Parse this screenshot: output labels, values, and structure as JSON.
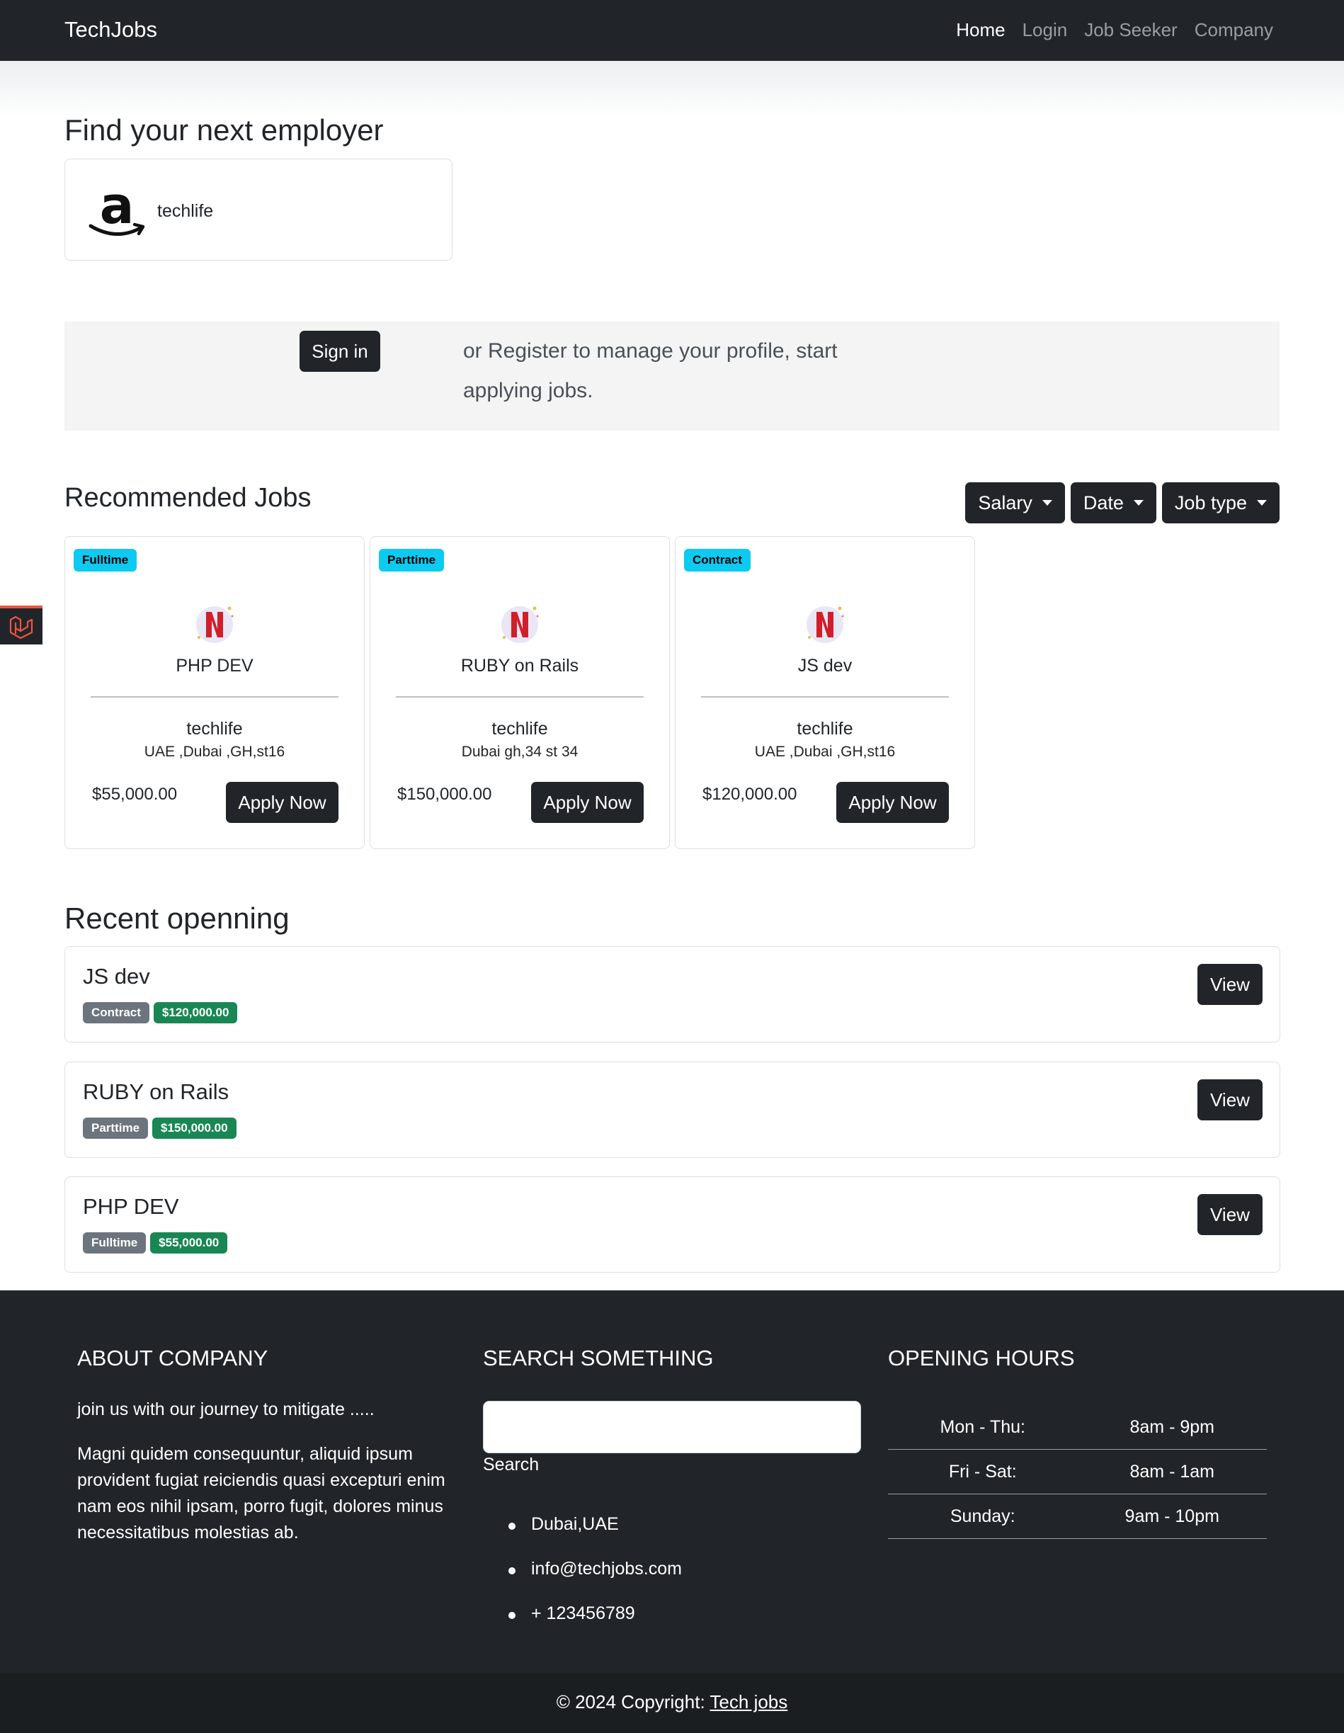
{
  "navbar": {
    "brand": "TechJobs",
    "links": [
      "Home",
      "Login",
      "Job Seeker",
      "Company"
    ],
    "active": "Home"
  },
  "employers": {
    "heading": "Find your next employer",
    "items": [
      {
        "name": "techlife",
        "logo": "amazon-logo"
      }
    ]
  },
  "banner": {
    "signin_label": "Sign in",
    "text": "or Register to manage your profile, start applying jobs."
  },
  "recommended": {
    "heading": "Recommended Jobs",
    "filters": [
      "Salary",
      "Date",
      "Job type"
    ],
    "jobs": [
      {
        "type": "Fulltime",
        "title": "PHP DEV",
        "company": "techlife",
        "location": "UAE ,Dubai ,GH,st16",
        "salary": "$55,000.00",
        "apply_label": "Apply Now",
        "logo": "netflix-logo"
      },
      {
        "type": "Parttime",
        "title": "RUBY on Rails",
        "company": "techlife",
        "location": "Dubai gh,34 st 34",
        "salary": "$150,000.00",
        "apply_label": "Apply Now",
        "logo": "netflix-logo"
      },
      {
        "type": "Contract",
        "title": "JS dev",
        "company": "techlife",
        "location": "UAE ,Dubai ,GH,st16",
        "salary": "$120,000.00",
        "apply_label": "Apply Now",
        "logo": "netflix-logo"
      }
    ]
  },
  "recent": {
    "heading": "Recent openning",
    "items": [
      {
        "title": "JS dev",
        "type": "Contract",
        "salary": "$120,000.00",
        "view_label": "View"
      },
      {
        "title": "RUBY on Rails",
        "type": "Parttime",
        "salary": "$150,000.00",
        "view_label": "View"
      },
      {
        "title": "PHP DEV",
        "type": "Fulltime",
        "salary": "$55,000.00",
        "view_label": "View"
      }
    ]
  },
  "footer": {
    "about": {
      "heading": "ABOUT COMPANY",
      "tagline": "join us with our journey to mitigate .....",
      "body": "Magni quidem consequuntur, aliquid ipsum provident fugiat reiciendis quasi excepturi enim nam eos nihil ipsam, porro fugit, dolores minus necessitatibus molestias ab."
    },
    "search": {
      "heading": "SEARCH SOMETHING",
      "input_value": "",
      "button_label": "Search",
      "contacts": [
        "Dubai,UAE",
        "info@techjobs.com",
        "+ 123456789"
      ]
    },
    "hours": {
      "heading": "OPENING HOURS",
      "rows": [
        {
          "day": "Mon - Thu:",
          "time": "8am - 9pm"
        },
        {
          "day": "Fri - Sat:",
          "time": "8am - 1am"
        },
        {
          "day": "Sunday:",
          "time": "9am - 10pm"
        }
      ]
    },
    "copyright_prefix": "© 2024 Copyright: ",
    "copyright_link": "Tech jobs"
  },
  "colors": {
    "dark": "#212529",
    "info_badge": "#0dcaf0",
    "secondary_badge": "#6c757d",
    "success_badge": "#198754",
    "laravel_red": "#f05340"
  }
}
